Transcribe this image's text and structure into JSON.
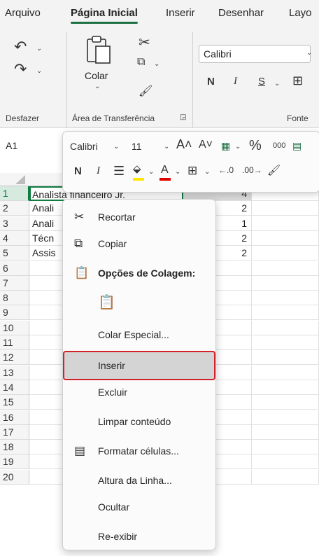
{
  "tabs": [
    "Arquivo",
    "Página Inicial",
    "Inserir",
    "Desenhar",
    "Layo"
  ],
  "ribbon": {
    "undo_group": "Desfazer",
    "clipboard_group": "Área de Transferência",
    "paste_label": "Colar",
    "font_group": "Fonte",
    "font_name": "Calibri",
    "bold": "N",
    "italic": "I",
    "underline": "S"
  },
  "name_box": "A1",
  "mini_toolbar": {
    "font_name": "Calibri",
    "font_size": "11",
    "bold": "N",
    "italic": "I",
    "percent": "%",
    "thousands": "000"
  },
  "rows": [
    "1",
    "2",
    "3",
    "4",
    "5",
    "6",
    "7",
    "8",
    "9",
    "10",
    "11",
    "12",
    "13",
    "14",
    "15",
    "16",
    "17",
    "18",
    "19",
    "20"
  ],
  "cells": [
    {
      "a": "Analista financeiro Jr.",
      "b": "4"
    },
    {
      "a": "Anali",
      "b": "2"
    },
    {
      "a": "Anali",
      "b": "1"
    },
    {
      "a": "Técn",
      "b": "2"
    },
    {
      "a": "Assis",
      "b": "2"
    }
  ],
  "context_menu": {
    "cut": "Recortar",
    "copy": "Copiar",
    "paste_options": "Opções de Colagem:",
    "paste_special": "Colar Especial...",
    "insert": "Inserir",
    "delete": "Excluir",
    "clear": "Limpar conteúdo",
    "format_cells": "Formatar células...",
    "row_height": "Altura da Linha...",
    "hide": "Ocultar",
    "unhide": "Re-exibir"
  },
  "colors": {
    "accent": "#107c41",
    "highlight_border": "#d1212b",
    "font_color": "#e00000",
    "fill_color": "#ffe600"
  }
}
